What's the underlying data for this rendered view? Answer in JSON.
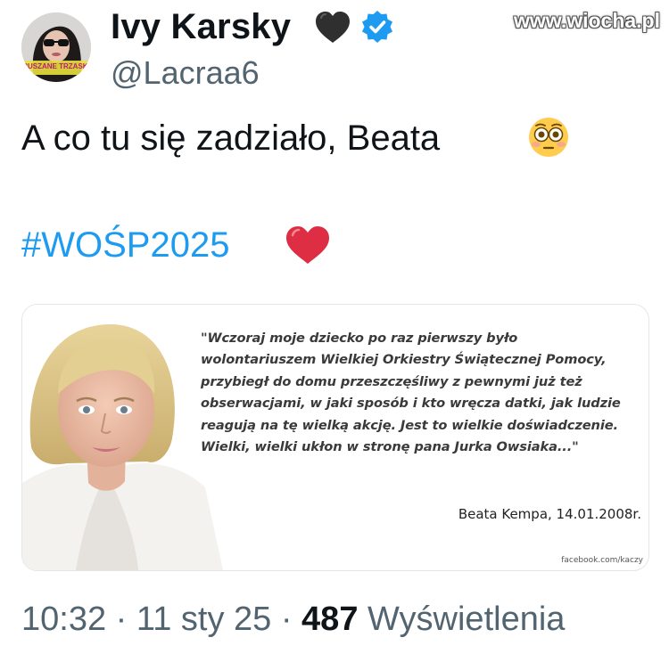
{
  "author": {
    "display_name": "Ivy Karsky",
    "handle": "@Lacraa6",
    "name_emoji_icon": "black-heart-icon",
    "verified_icon": "verified-badge-icon",
    "avatar_badge_text": "RUSZANE TRZASKI"
  },
  "watermark": "www.wiocha.pl",
  "tweet": {
    "text": "A co tu się zadziało, Beata",
    "text_emoji_icon": "flushed-face-icon",
    "hashtag": "#WOŚP2025",
    "hashtag_emoji_icon": "red-heart-icon"
  },
  "media": {
    "quote": "\"Wczoraj moje dziecko po raz pierwszy było\nwolontariuszem Wielkiej Orkiestry Świątecznej Pomocy,\nprzybiegł do domu przeszczęśliwy z pewnymi już też\nobserwacjami, w jaki sposób i kto wręcza datki, jak ludzie\nreagują na tę wielką akcję. Jest to wielkie doświadczenie.\nWielki, wielki ukłon w stronę pana Jurka Owsiaka...\"",
    "signature": "Beata Kempa, 14.01.2008r.",
    "source": "facebook.com/kaczy"
  },
  "meta": {
    "time": "10:32",
    "separator": "·",
    "date": "11 sty 25",
    "views_count": "487",
    "views_label": "Wyświetlenia"
  },
  "colors": {
    "hashtag": "#1d9bf0",
    "secondary_text": "#536471",
    "primary_text": "#0f1419",
    "verified": "#1d9bf0"
  }
}
